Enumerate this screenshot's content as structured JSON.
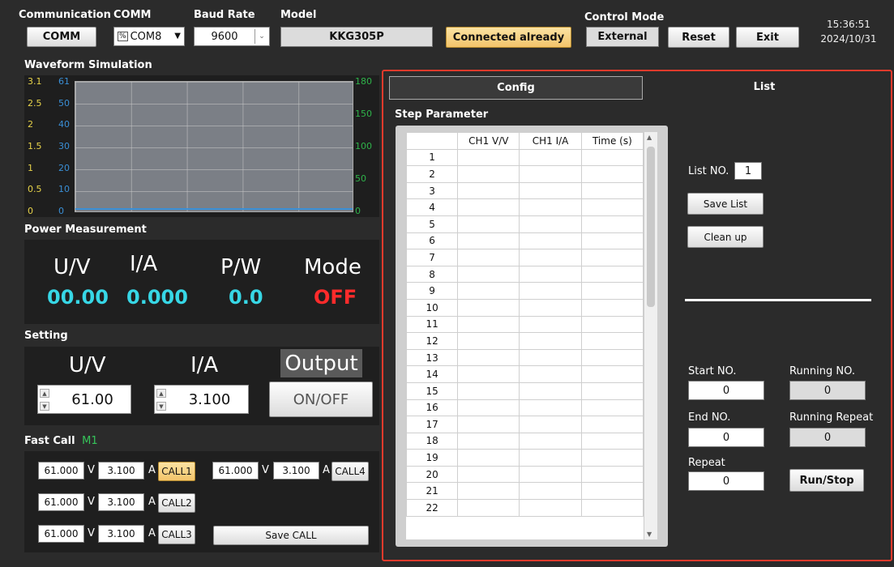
{
  "header": {
    "communication_label": "Communication",
    "comm_label": "COMM",
    "baud_label": "Baud Rate",
    "model_label": "Model",
    "control_mode_label": "Control Mode",
    "comm_button": "COMM",
    "comm_port": "COM8",
    "baud_value": "9600",
    "model_value": "KKG305P",
    "connected_button": "Connected already",
    "control_mode_value": "External",
    "reset_button": "Reset",
    "exit_button": "Exit",
    "time": "15:36:51",
    "date": "2024/10/31"
  },
  "waveform": {
    "title": "Waveform Simulation",
    "left_ticks": [
      "3.1",
      "2.5",
      "2",
      "1.5",
      "1",
      "0.5",
      "0"
    ],
    "mid_ticks": [
      "61",
      "50",
      "40",
      "30",
      "20",
      "10",
      "0"
    ],
    "right_ticks": [
      "180",
      "150",
      "100",
      "50",
      "0"
    ]
  },
  "power": {
    "title": "Power  Measurement",
    "u_label": "U/V",
    "i_label": "I/A",
    "p_label": "P/W",
    "mode_label": "Mode",
    "u_value": "00.00",
    "i_value": "0.000",
    "p_value": "0.0",
    "mode_value": "OFF"
  },
  "setting": {
    "title": "Setting",
    "u_label": "U/V",
    "i_label": "I/A",
    "output_label": "Output",
    "u_value": "61.00",
    "i_value": "3.100",
    "onoff_button": "ON/OFF"
  },
  "fastcall": {
    "title": "Fast Call",
    "memory": "M1",
    "v_unit": "V",
    "a_unit": "A",
    "calls": [
      {
        "v": "61.000",
        "a": "3.100",
        "label": "CALL1"
      },
      {
        "v": "61.000",
        "a": "3.100",
        "label": "CALL2"
      },
      {
        "v": "61.000",
        "a": "3.100",
        "label": "CALL3"
      },
      {
        "v": "61.000",
        "a": "3.100",
        "label": "CALL4"
      }
    ],
    "save_button": "Save CALL"
  },
  "tabs": {
    "config": "Config",
    "list": "List"
  },
  "list": {
    "step_title": "Step Parameter",
    "columns": [
      "CH1 V/V",
      "CH1 I/A",
      "Time (s)"
    ],
    "rows": [
      "1",
      "2",
      "3",
      "4",
      "5",
      "6",
      "7",
      "8",
      "9",
      "10",
      "11",
      "12",
      "13",
      "14",
      "15",
      "16",
      "17",
      "18",
      "19",
      "20",
      "21",
      "22"
    ],
    "list_no_label": "List NO.",
    "list_no_value": "1",
    "save_list_button": "Save List",
    "clean_up_button": "Clean up",
    "start_no_label": "Start NO.",
    "start_no_value": "0",
    "running_no_label": "Running NO.",
    "running_no_value": "0",
    "end_no_label": "End NO.",
    "end_no_value": "0",
    "running_repeat_label": "Running Repeat",
    "running_repeat_value": "0",
    "repeat_label": "Repeat",
    "repeat_value": "0",
    "run_stop_button": "Run/Stop"
  },
  "colors": {
    "highlight": "#e53a2c",
    "cyan": "#37d7e6",
    "off_red": "#ff2b2b",
    "yellow_axis": "#e7d34a",
    "blue_axis": "#3a8fd6",
    "green_axis": "#2fb34a"
  }
}
